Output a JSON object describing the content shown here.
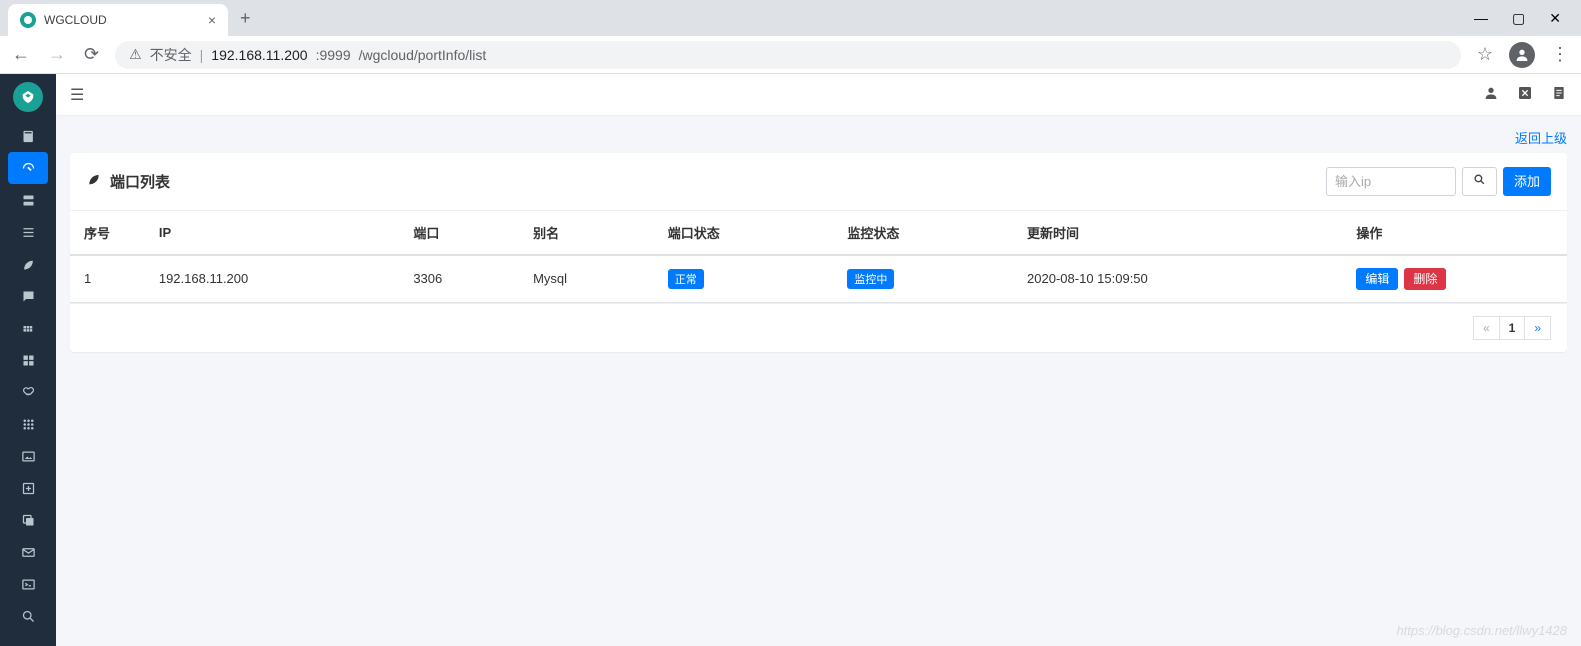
{
  "browser": {
    "tab_title": "WGCLOUD",
    "insecure_label": "不安全",
    "url_host": "192.168.11.200",
    "url_port": ":9999",
    "url_path": "/wgcloud/portInfo/list"
  },
  "topbar": {
    "user_icon": "person",
    "close_icon": "close",
    "doc_icon": "doc"
  },
  "page": {
    "back_link": "返回上级",
    "title": "端口列表",
    "search_placeholder": "输入ip",
    "add_button": "添加"
  },
  "table": {
    "headers": [
      "序号",
      "IP",
      "端口",
      "别名",
      "端口状态",
      "监控状态",
      "更新时间",
      "操作"
    ],
    "rows": [
      {
        "seq": "1",
        "ip": "192.168.11.200",
        "port": "3306",
        "alias": "Mysql",
        "port_status": "正常",
        "monitor_status": "监控中",
        "updated": "2020-08-10 15:09:50",
        "edit": "编辑",
        "delete": "删除"
      }
    ]
  },
  "pagination": {
    "prev": "«",
    "current": "1",
    "next": "»"
  },
  "watermark": "https://blog.csdn.net/llwy1428"
}
